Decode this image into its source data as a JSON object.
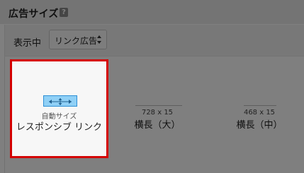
{
  "header": {
    "title": "広告サイズ",
    "help_icon": "?"
  },
  "toolbar": {
    "display_label": "表示中",
    "select_value": "リンク広告"
  },
  "tiles": [
    {
      "sub_label": "自動サイズ",
      "main_label": "レスポンシブ リンク",
      "selected": true
    },
    {
      "size": "728 x 15",
      "label": "横長（大）"
    },
    {
      "size": "468 x 15",
      "label": "横長（中）"
    }
  ],
  "colors": {
    "selected_border": "#d40000",
    "resize_icon_fill": "#8fd0f6",
    "resize_icon_stroke": "#2e8fd6"
  },
  "icons": [
    "help-icon",
    "select-arrows-icon",
    "resize-icon"
  ]
}
